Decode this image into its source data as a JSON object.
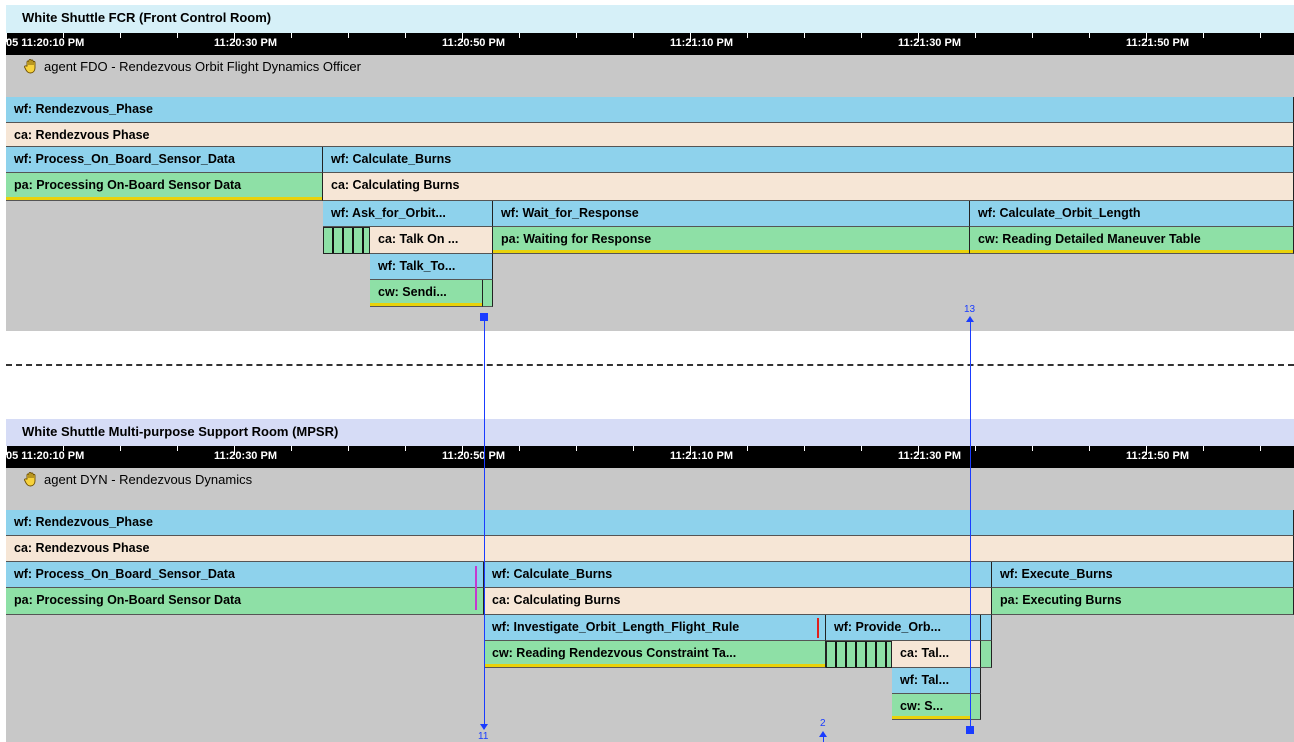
{
  "fcr": {
    "title": "White Shuttle FCR (Front Control Room)",
    "agent": "agent FDO - Rendezvous Orbit Flight Dynamics Officer",
    "ticks": [
      "05 11:20:10 PM",
      "11:20:30 PM",
      "11:20:50 PM",
      "11:21:10 PM",
      "11:21:30 PM",
      "11:21:50 PM"
    ],
    "rows": {
      "wf_phase": "wf: Rendezvous_Phase",
      "ca_phase": "ca: Rendezvous Phase",
      "wf_process": "wf: Process_On_Board_Sensor_Data",
      "pa_process": "pa: Processing On-Board Sensor Data",
      "wf_calc": "wf: Calculate_Burns",
      "ca_calc": "ca: Calculating Burns",
      "wf_ask": "wf: Ask_for_Orbit...",
      "wf_wait": "wf: Wait_for_Response",
      "wf_orbit_len": "wf: Calculate_Orbit_Length",
      "ca_talk_on": "ca: Talk On ...",
      "pa_wait": "pa: Waiting for Response",
      "cw_reading": "cw: Reading Detailed Maneuver Table",
      "wf_talk_to": "wf: Talk_To...",
      "cw_sendi": "cw: Sendi..."
    }
  },
  "mpsr": {
    "title": "White Shuttle Multi-purpose Support Room (MPSR)",
    "agent": "agent DYN - Rendezvous Dynamics",
    "ticks": [
      "05 11:20:10 PM",
      "11:20:30 PM",
      "11:20:50 PM",
      "11:21:10 PM",
      "11:21:30 PM",
      "11:21:50 PM"
    ],
    "rows": {
      "wf_phase": "wf: Rendezvous_Phase",
      "ca_phase": "ca: Rendezvous Phase",
      "wf_process": "wf: Process_On_Board_Sensor_Data",
      "pa_process": "pa: Processing On-Board Sensor Data",
      "wf_calc": "wf: Calculate_Burns",
      "wf_exec": "wf: Execute_Burns",
      "ca_calc": "ca: Calculating Burns",
      "pa_exec": "pa: Executing Burns",
      "wf_investigate": "wf: Investigate_Orbit_Length_Flight_Rule",
      "wf_provide": "wf: Provide_Orb...",
      "cw_reading": "cw: Reading Rendezvous Constraint Ta...",
      "ca_tal": "ca: Tal...",
      "wf_tal": "wf: Tal...",
      "cw_s": "cw: S..."
    }
  },
  "comms": {
    "c11": "11",
    "c13": "13",
    "c2": "2"
  },
  "colors": {
    "wf": "#8ed2ec",
    "ca": "#f6e6d6",
    "pa": "#8ee0a6",
    "lane": "#c8c8c8",
    "fcr_header": "#d6f0f8",
    "mpsr_header": "#d6dcf6",
    "comm": "#1a3cff"
  }
}
